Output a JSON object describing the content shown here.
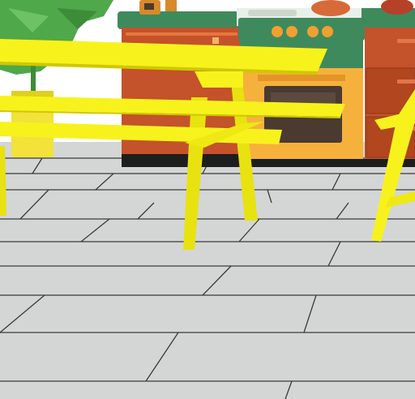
{
  "scene": {
    "description_tag": "",
    "colors": {
      "floor": "#d4d6d5",
      "floor_dark": "#c2c4c3",
      "grout": "#3a3a3a",
      "wall": "#ffffff",
      "cabinet": "#c4522a",
      "cabinet_dark": "#8e3618",
      "counter_top": "#3f8a5c",
      "stove_green": "#3f8a5c",
      "oven_orange": "#f6b13c",
      "oven_window": "#4a3a30",
      "knob": "#f0a030",
      "table_yellow": "#f7f21c",
      "table_yellow_dark": "#cfc800",
      "plant_green": "#4fa84a",
      "pot_yellow": "#f2e23a"
    },
    "stove_knob_count": 4,
    "objects": [
      "kitchen-counter",
      "stove-oven",
      "right-cabinet",
      "picnic-table",
      "yellow-chair",
      "potted-plant",
      "tiled-floor"
    ]
  }
}
